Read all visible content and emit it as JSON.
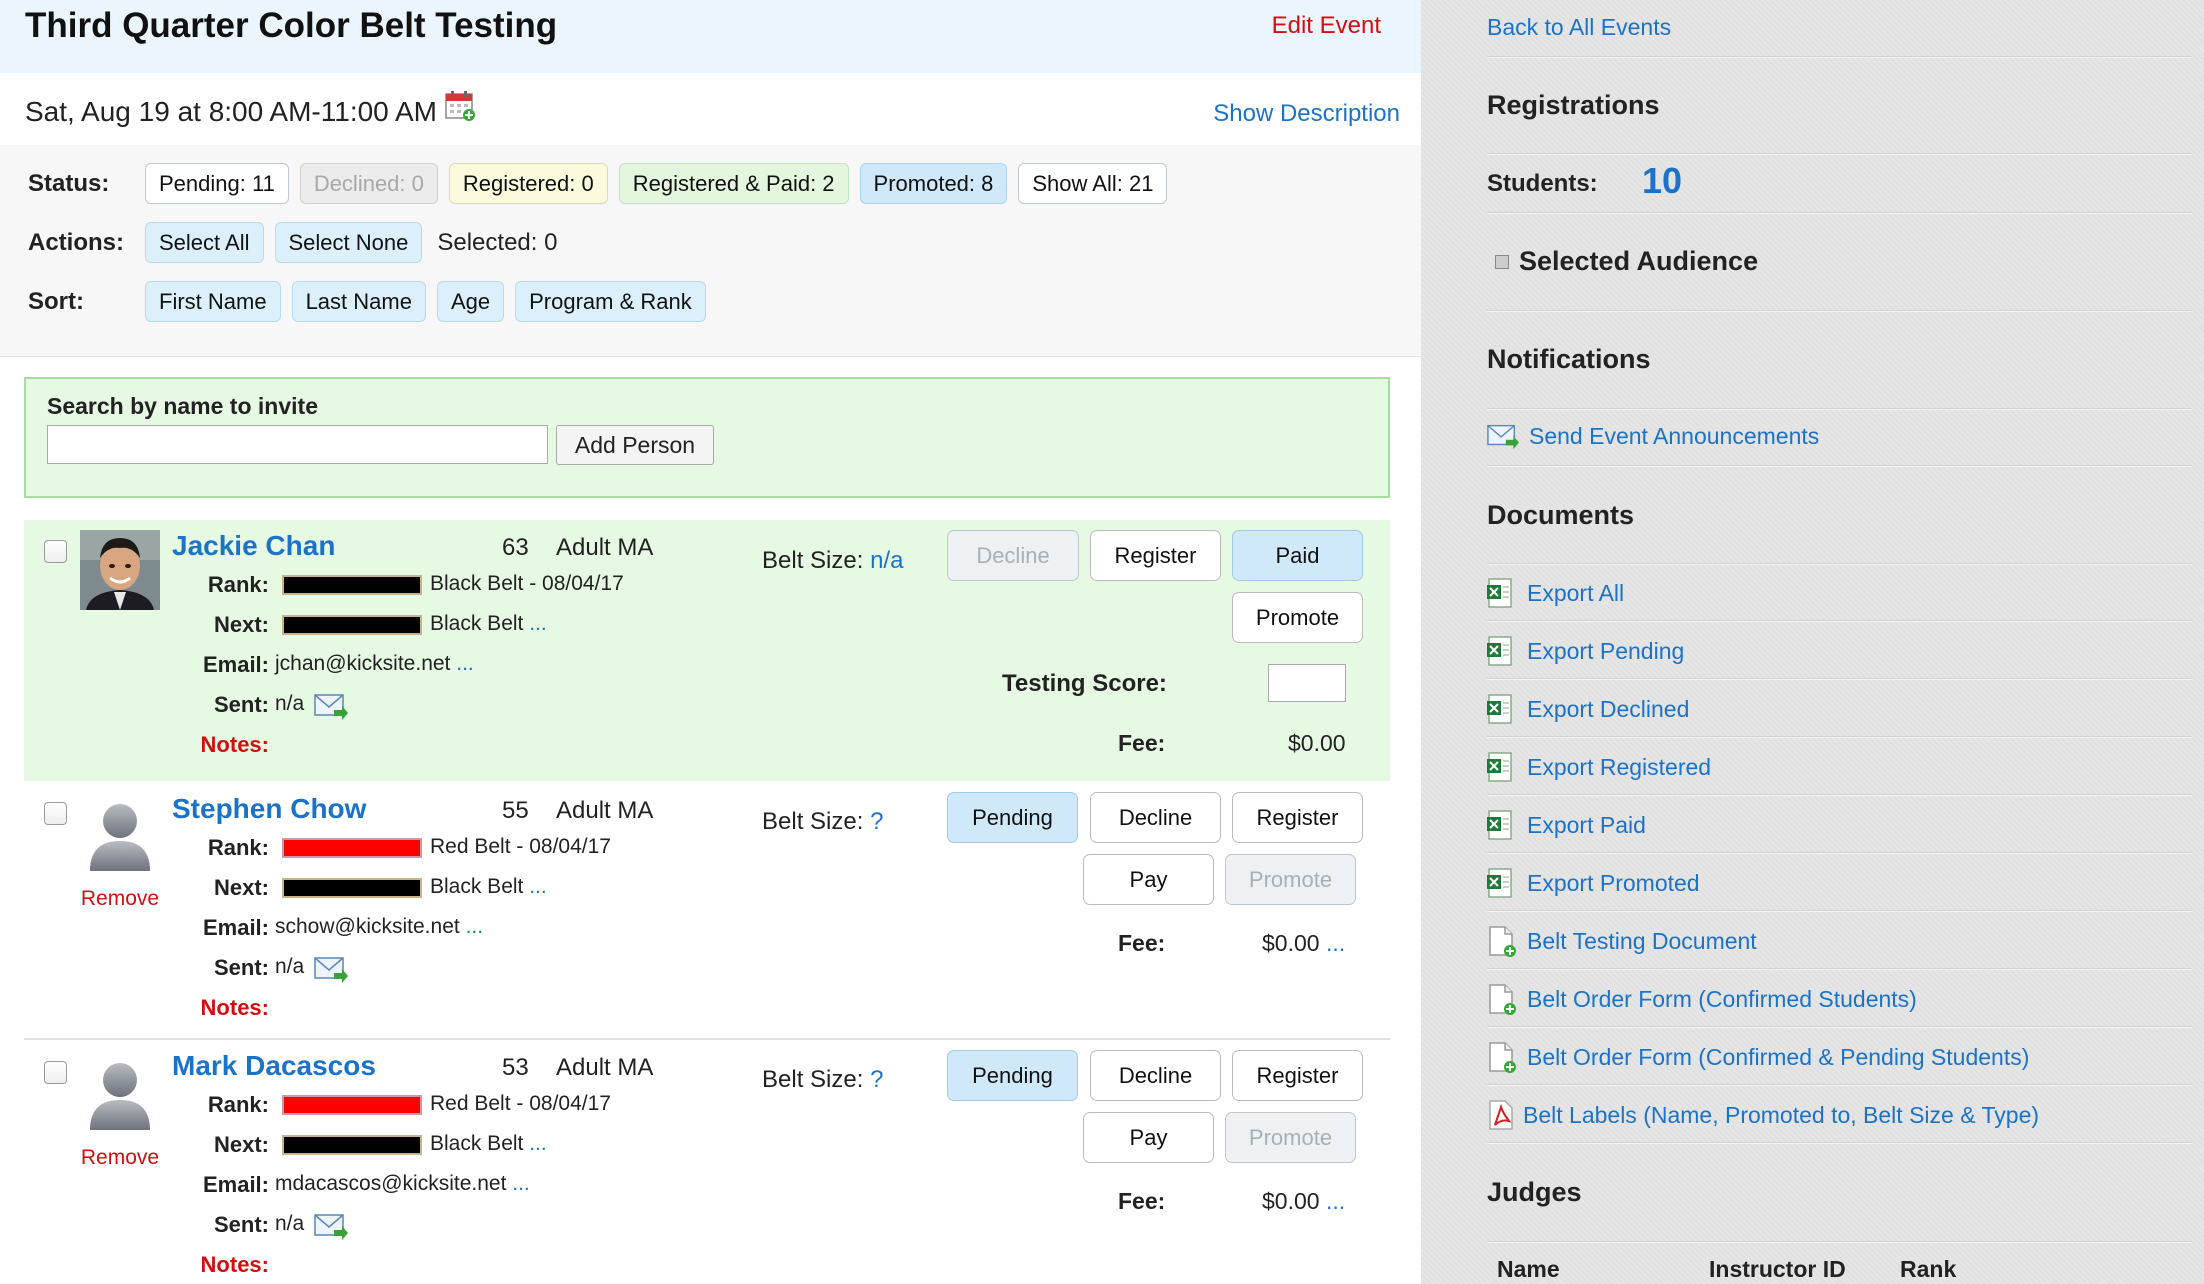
{
  "event": {
    "title": "Third Quarter Color Belt Testing",
    "edit_label": "Edit Event",
    "datetime": "Sat, Aug 19 at 8:00 AM-11:00 AM",
    "show_description": "Show Description"
  },
  "controls": {
    "status_label": "Status:",
    "status_chips": [
      "Pending: 11",
      "Declined: 0",
      "Registered: 0",
      "Registered & Paid: 2",
      "Promoted: 8",
      "Show All: 21"
    ],
    "actions_label": "Actions:",
    "select_all": "Select All",
    "select_none": "Select None",
    "selected_text": "Selected: 0",
    "sort_label": "Sort:",
    "sort_chips": [
      "First Name",
      "Last Name",
      "Age",
      "Program & Rank"
    ]
  },
  "search": {
    "label": "Search by name to invite",
    "placeholder": "",
    "add_button": "Add Person"
  },
  "labels": {
    "rank": "Rank:",
    "next": "Next:",
    "email": "Email:",
    "sent": "Sent:",
    "notes": "Notes:",
    "belt_size": "Belt Size:",
    "testing_score": "Testing Score:",
    "fee": "Fee:",
    "remove": "Remove",
    "more": "...",
    "decline": "Decline",
    "register": "Register",
    "paid": "Paid",
    "promote": "Promote",
    "pending": "Pending",
    "pay": "Pay"
  },
  "students": [
    {
      "name": "Jackie Chan",
      "age": "63",
      "program": "Adult MA",
      "rank": "Black Belt - 08/04/17",
      "next": "Black Belt",
      "email": "jchan@kicksite.net",
      "sent": "n/a",
      "belt_size": "n/a",
      "fee": "$0.00"
    },
    {
      "name": "Stephen Chow",
      "age": "55",
      "program": "Adult MA",
      "rank": "Red Belt - 08/04/17",
      "next": "Black Belt",
      "email": "schow@kicksite.net",
      "sent": "n/a",
      "belt_size": "?",
      "fee": "$0.00"
    },
    {
      "name": "Mark Dacascos",
      "age": "53",
      "program": "Adult MA",
      "rank": "Red Belt - 08/04/17",
      "next": "Black Belt",
      "email": "mdacascos@kicksite.net",
      "sent": "n/a",
      "belt_size": "?",
      "fee": "$0.00"
    }
  ],
  "sidebar": {
    "back_link": "Back to All Events",
    "registrations_heading": "Registrations",
    "students_label": "Students:",
    "students_count": "10",
    "selected_audience": "Selected Audience",
    "notifications_heading": "Notifications",
    "send_announcements": "Send Event Announcements",
    "documents_heading": "Documents",
    "documents": [
      "Export All",
      "Export Pending",
      "Export Declined",
      "Export Registered",
      "Export Paid",
      "Export Promoted",
      "Belt Testing Document",
      "Belt Order Form (Confirmed Students)",
      "Belt Order Form (Confirmed & Pending Students)",
      "Belt Labels (Name, Promoted to, Belt Size & Type)"
    ],
    "judges_heading": "Judges",
    "judges_columns": [
      "Name",
      "Instructor ID",
      "Rank"
    ]
  },
  "colors": {
    "link": "#1a73c8",
    "danger": "#d01010",
    "header_bg": "#eaf5fd",
    "highlight_bg": "#e6f9e2",
    "sidebar_bg": "#e4e4e4"
  },
  "icons": {
    "calendar": "calendar-add-icon",
    "mail": "mail-send-icon",
    "excel": "excel-file-icon",
    "document": "document-add-icon",
    "pdf": "pdf-file-icon"
  }
}
